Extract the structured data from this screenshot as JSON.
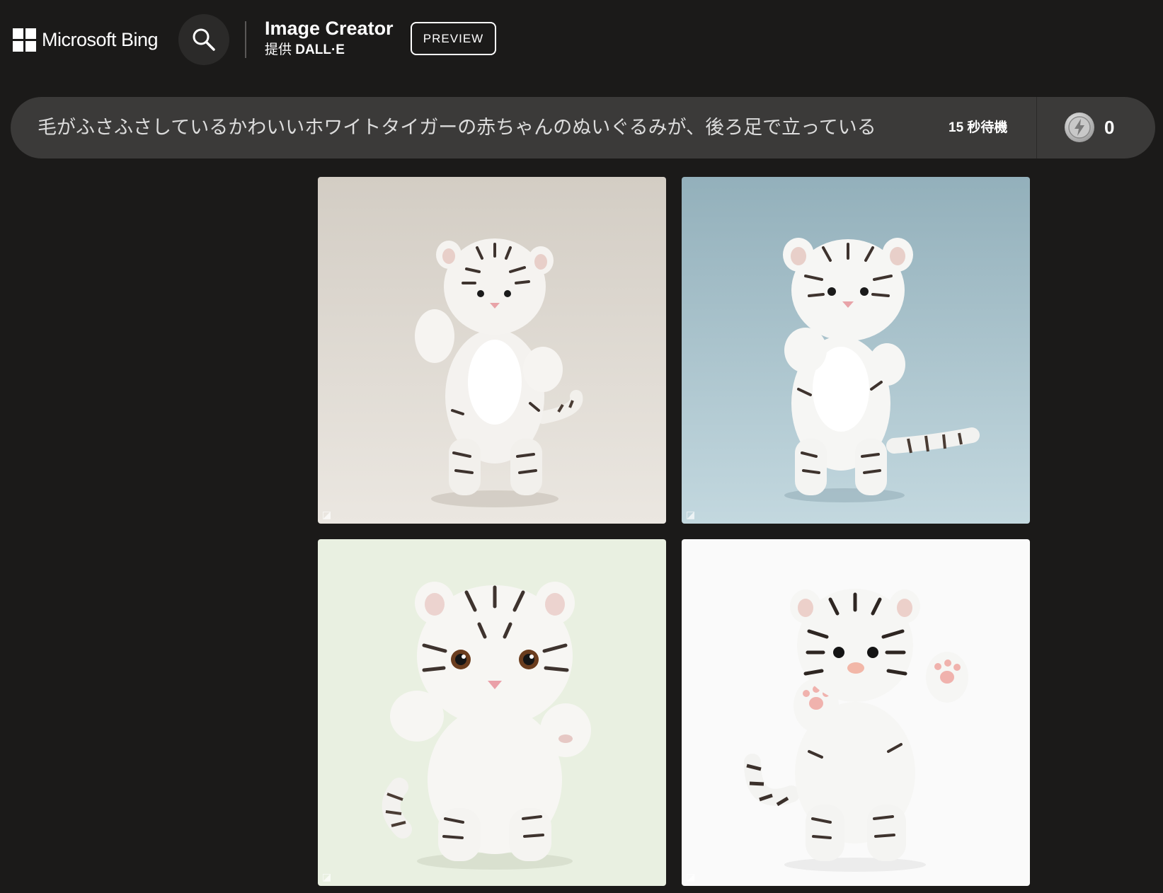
{
  "header": {
    "logo_text": "Microsoft Bing",
    "brand_title": "Image Creator",
    "brand_sub_prefix": "提供",
    "brand_sub_name": "DALL·E",
    "preview_label": "PREVIEW"
  },
  "prompt": {
    "text": "毛がふさふさしているかわいいホワイトタイガーの赤ちゃんのぬいぐるみが、後ろ足で立っている",
    "wait_text": "15 秒待機",
    "boost_count": "0"
  },
  "results": {
    "images": [
      {
        "subject": "white-tiger-plush",
        "background": "#dcd7cf"
      },
      {
        "subject": "white-tiger-plush",
        "background": "#a7c1ca"
      },
      {
        "subject": "white-tiger-plush",
        "background": "#e9f0e1"
      },
      {
        "subject": "white-tiger-plush",
        "background": "#fafafa"
      }
    ]
  },
  "colors": {
    "page_background": "#1b1a19",
    "prompt_bar": "#3b3a39",
    "text": "#ffffff"
  },
  "icons": [
    "search-icon",
    "boost-coin-icon",
    "dalle-watermark-icon"
  ]
}
